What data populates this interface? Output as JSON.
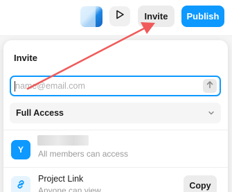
{
  "header": {
    "invite_label": "Invite",
    "publish_label": "Publish",
    "accent_color": "#0d99ff"
  },
  "invite_panel": {
    "title": "Invite",
    "email_placeholder": "name@email.com",
    "access_level": "Full Access"
  },
  "members": [
    {
      "initial": "Y",
      "subtitle": "All members can access"
    }
  ],
  "project_link": {
    "title": "Project Link",
    "subtitle": "Anyone can view",
    "copy_label": "Copy"
  },
  "annotation": {
    "arrow_color": "#f05a5a"
  },
  "icons": [
    "play-icon",
    "send-arrow-up-icon",
    "chevron-down-icon",
    "link-icon"
  ]
}
